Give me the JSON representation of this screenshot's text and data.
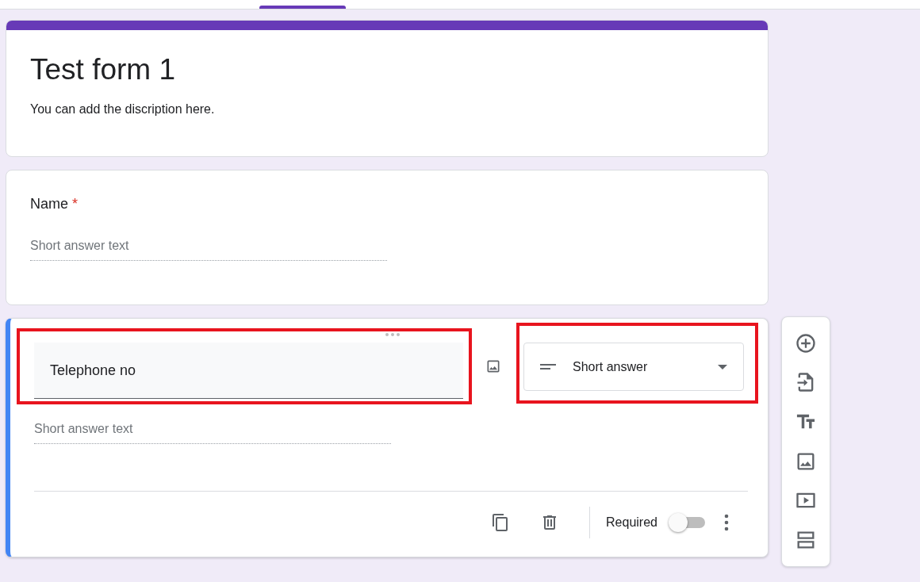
{
  "form": {
    "title": "Test form 1",
    "description": "You can add the discription here."
  },
  "questions": [
    {
      "title": "Name",
      "required": true,
      "required_mark": "*",
      "placeholder": "Short answer text"
    }
  ],
  "active_question": {
    "title": "Telephone no",
    "type": "Short answer",
    "placeholder": "Short answer text",
    "required_label": "Required",
    "required": false,
    "highlighted": true
  },
  "toolbar": [
    {
      "kind": "add"
    },
    {
      "kind": "import"
    },
    {
      "kind": "title"
    },
    {
      "kind": "image"
    },
    {
      "kind": "video"
    },
    {
      "kind": "section"
    }
  ]
}
